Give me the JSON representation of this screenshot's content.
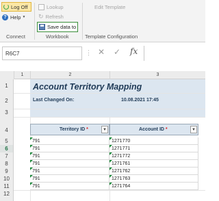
{
  "ribbon": {
    "log_off": "Log Off",
    "help": "Help",
    "lookup": "Lookup",
    "refresh": "Refresh",
    "save_data_to": "Save data to",
    "edit_template": "Edit Template",
    "groups": {
      "connect": "Connect",
      "workbook": "Workbook",
      "template_configuration": "Template Configuration"
    }
  },
  "formula_bar": {
    "name_box": "R6C7",
    "formula": "",
    "fx": "fx"
  },
  "sheet": {
    "columns": [
      "1",
      "2",
      "3"
    ],
    "rows": [
      "1",
      "2",
      "3",
      "4",
      "5",
      "6",
      "7",
      "8",
      "9",
      "10",
      "11",
      "12"
    ],
    "selected_row": "6",
    "title": "Account Territory Mapping",
    "last_changed_label": "Last Changed On:",
    "last_changed_value": "10.08.2021 17:45",
    "table_headers": {
      "territory_id": "Territory ID",
      "account_id": "Account ID",
      "required_mark": "*"
    },
    "table_rows": [
      [
        "791",
        "1271770"
      ],
      [
        "791",
        "1271771"
      ],
      [
        "791",
        "1271772"
      ],
      [
        "791",
        "1271761"
      ],
      [
        "791",
        "1271762"
      ],
      [
        "791",
        "1271763"
      ],
      [
        "791",
        "1271764"
      ]
    ]
  }
}
